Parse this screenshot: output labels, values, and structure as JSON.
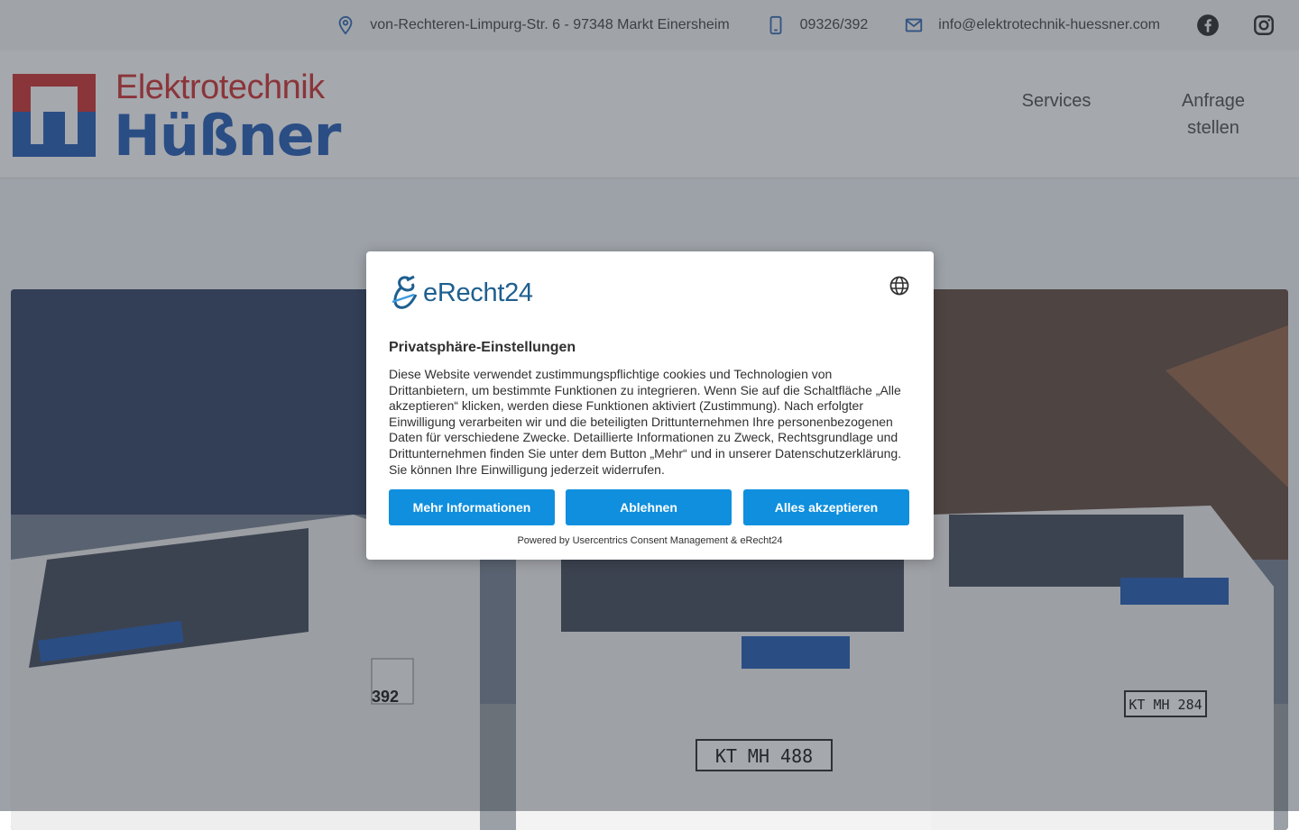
{
  "topbar": {
    "address": "von-Rechteren-Limpurg-Str. 6 - 97348 Markt Einersheim",
    "phone": "09326/392",
    "email": "info@elektrotechnik-huessner.com"
  },
  "logo": {
    "line1": "Elektrotechnik",
    "line2": "Hüßner"
  },
  "nav": {
    "services": "Services",
    "anfrage_line1": "Anfrage",
    "anfrage_line2": "stellen"
  },
  "hero": {
    "plates": [
      "KT MH 488",
      "KT MH 284"
    ],
    "van_number": "392"
  },
  "consent": {
    "brand": "eRecht24",
    "title": "Privatsphäre-Einstellungen",
    "text": "Diese Website verwendet zustimmungspflichtige cookies und Technologien von Drittanbietern, um bestimmte Funktionen zu integrieren. Wenn Sie auf die Schaltfläche „Alle akzeptieren“ klicken, werden diese Funktionen aktiviert (Zustimmung). Nach erfolgter Einwilligung verarbeiten wir und die beteiligten Drittunternehmen Ihre personenbezogenen Daten für verschiedene Zwecke. Detaillierte Informationen zu Zweck, Rechtsgrundlage und Drittunternehmen finden Sie unter dem Button „Mehr“ und in unserer Datenschutzerklärung. Sie können Ihre Einwilligung jederzeit widerrufen.",
    "btn_more": "Mehr Informationen",
    "btn_deny": "Ablehnen",
    "btn_accept": "Alles akzeptieren",
    "powered": "Powered by Usercentrics Consent Management & eRecht24"
  },
  "colors": {
    "accent_blue": "#0f8fde",
    "logo_red": "#d13a3a",
    "logo_blue": "#2c63b8"
  },
  "icons": {
    "address": "map-pin-icon",
    "phone": "phone-icon",
    "email": "mail-icon",
    "social": [
      "facebook-icon",
      "instagram-icon"
    ],
    "language": "globe-icon"
  }
}
